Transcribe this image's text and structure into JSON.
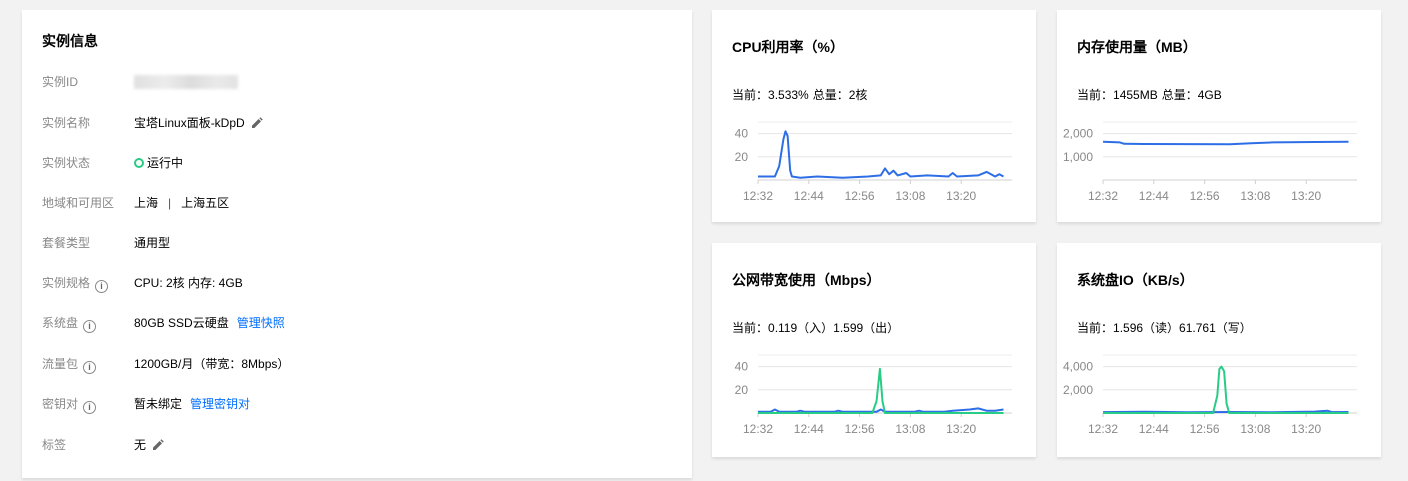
{
  "info": {
    "title": "实例信息",
    "rows": [
      {
        "label": "实例ID",
        "value": ""
      },
      {
        "label": "实例名称",
        "value": "宝塔Linux面板-kDpD"
      },
      {
        "label": "实例状态",
        "value": "运行中"
      },
      {
        "label": "地域和可用区",
        "region": "上海",
        "separator": "|",
        "zone": "上海五区"
      },
      {
        "label": "套餐类型",
        "value": "通用型"
      },
      {
        "label": "实例规格",
        "value": "CPU: 2核 内存: 4GB"
      },
      {
        "label": "系统盘",
        "value": "80GB SSD云硬盘",
        "link": "管理快照"
      },
      {
        "label": "流量包",
        "value": "1200GB/月（带宽：8Mbps）"
      },
      {
        "label": "密钥对",
        "value": "暂未绑定",
        "link": "管理密钥对"
      },
      {
        "label": "标签",
        "value": "无"
      }
    ],
    "status_color": "#29cc85",
    "link_color": "#006eff"
  },
  "charts": {
    "cpu": {
      "title": "CPU利用率（%）",
      "current_label": "当前：",
      "current": "3.533%",
      "total_label": "总量：",
      "total": "2核"
    },
    "mem": {
      "title": "内存使用量（MB）",
      "current_label": "当前：",
      "current": "1455MB",
      "total_label": "总量：",
      "total": "4GB"
    },
    "net": {
      "title": "公网带宽使用（Mbps）",
      "current_label": "当前：",
      "current": "0.119（入）1.599（出）"
    },
    "disk": {
      "title": "系统盘IO（KB/s）",
      "current_label": "当前：",
      "current": "1.596（读）61.761（写）"
    }
  },
  "chart_data": [
    {
      "type": "line",
      "title": "CPU利用率（%）",
      "x_ticks": [
        "12:32",
        "12:44",
        "12:56",
        "13:08",
        "13:20"
      ],
      "y_ticks": [
        "20",
        "40"
      ],
      "ylim": [
        0,
        50
      ],
      "series": [
        {
          "color": "#2d6ee6",
          "points": [
            [
              0,
              3
            ],
            [
              4,
              3
            ],
            [
              5,
              12
            ],
            [
              6,
              35
            ],
            [
              6.5,
              42
            ],
            [
              7,
              38
            ],
            [
              7.6,
              8
            ],
            [
              8,
              3
            ],
            [
              10,
              2
            ],
            [
              14,
              3
            ],
            [
              20,
              2
            ],
            [
              26,
              3
            ],
            [
              29,
              4
            ],
            [
              30,
              10
            ],
            [
              31,
              5
            ],
            [
              32,
              8
            ],
            [
              33,
              4
            ],
            [
              35,
              6
            ],
            [
              36,
              3
            ],
            [
              40,
              4
            ],
            [
              45,
              3
            ],
            [
              46,
              6
            ],
            [
              47,
              3
            ],
            [
              52,
              4
            ],
            [
              54,
              7
            ],
            [
              56,
              3
            ],
            [
              57,
              5
            ],
            [
              58,
              3
            ]
          ]
        }
      ]
    },
    {
      "type": "line",
      "title": "内存使用量（MB）",
      "x_ticks": [
        "12:32",
        "12:44",
        "12:56",
        "13:08",
        "13:20"
      ],
      "y_ticks": [
        "1,000",
        "2,000"
      ],
      "ylim": [
        0,
        2500
      ],
      "series": [
        {
          "color": "#2d6ee6",
          "points": [
            [
              0,
              1650
            ],
            [
              4,
              1620
            ],
            [
              5,
              1560
            ],
            [
              10,
              1550
            ],
            [
              30,
              1545
            ],
            [
              35,
              1580
            ],
            [
              40,
              1620
            ],
            [
              50,
              1640
            ],
            [
              58,
              1650
            ]
          ]
        }
      ]
    },
    {
      "type": "line",
      "title": "公网带宽使用（Mbps）",
      "x_ticks": [
        "12:32",
        "12:44",
        "12:56",
        "13:08",
        "13:20"
      ],
      "y_ticks": [
        "20",
        "40"
      ],
      "ylim": [
        0,
        50
      ],
      "series": [
        {
          "name": "入",
          "color": "#2d6ee6",
          "points": [
            [
              0,
              1
            ],
            [
              3,
              1
            ],
            [
              4,
              3
            ],
            [
              5,
              1
            ],
            [
              9,
              1
            ],
            [
              10,
              2
            ],
            [
              11,
              1
            ],
            [
              18,
              1
            ],
            [
              19,
              2
            ],
            [
              20,
              1
            ],
            [
              28,
              1
            ],
            [
              29,
              3
            ],
            [
              30,
              1
            ],
            [
              37,
              1
            ],
            [
              38,
              2
            ],
            [
              39,
              1
            ],
            [
              44,
              1
            ],
            [
              46,
              2
            ],
            [
              50,
              3
            ],
            [
              52,
              4
            ],
            [
              54,
              2
            ],
            [
              56,
              2
            ],
            [
              58,
              3
            ]
          ]
        },
        {
          "name": "出",
          "color": "#29cc85",
          "points": [
            [
              0,
              0
            ],
            [
              27,
              0
            ],
            [
              28,
              10
            ],
            [
              28.8,
              38
            ],
            [
              29.4,
              10
            ],
            [
              30,
              0
            ],
            [
              58,
              0
            ]
          ]
        }
      ]
    },
    {
      "type": "line",
      "title": "系统盘IO（KB/s）",
      "x_ticks": [
        "12:32",
        "12:44",
        "12:56",
        "13:08",
        "13:20"
      ],
      "y_ticks": [
        "2,000",
        "4,000"
      ],
      "ylim": [
        0,
        5000
      ],
      "series": [
        {
          "name": "读",
          "color": "#2d6ee6",
          "points": [
            [
              0,
              80
            ],
            [
              10,
              100
            ],
            [
              20,
              60
            ],
            [
              30,
              90
            ],
            [
              40,
              70
            ],
            [
              50,
              120
            ],
            [
              53,
              200
            ],
            [
              54,
              80
            ],
            [
              58,
              90
            ]
          ]
        },
        {
          "name": "写",
          "color": "#29cc85",
          "points": [
            [
              0,
              0
            ],
            [
              26,
              0
            ],
            [
              27,
              1500
            ],
            [
              27.5,
              3800
            ],
            [
              28,
              4000
            ],
            [
              28.6,
              3600
            ],
            [
              29.2,
              800
            ],
            [
              29.8,
              0
            ],
            [
              58,
              0
            ]
          ]
        }
      ]
    }
  ]
}
